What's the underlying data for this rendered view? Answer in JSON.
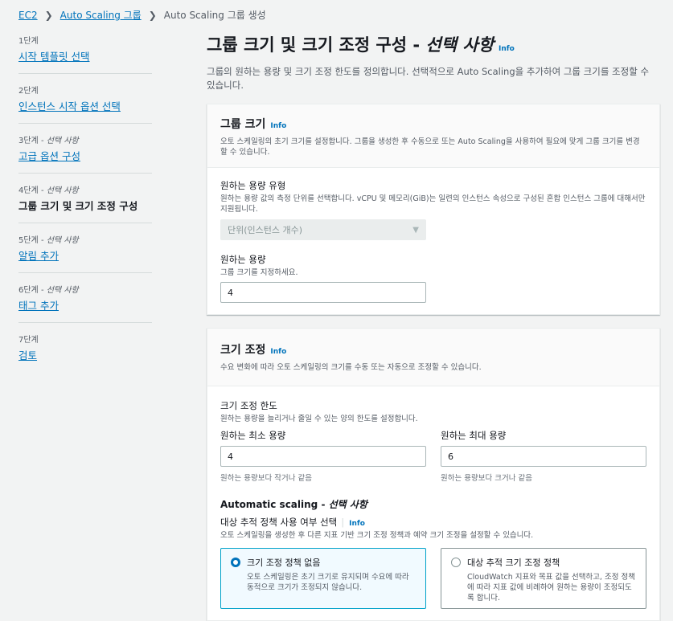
{
  "breadcrumb": {
    "items": [
      "EC2",
      "Auto Scaling 그룹"
    ],
    "current": "Auto Scaling 그룹 생성"
  },
  "steps": [
    {
      "num": "1단계",
      "optional": "",
      "label": "시작 템플릿 선택"
    },
    {
      "num": "2단계",
      "optional": "",
      "label": "인스턴스 시작 옵션 선택"
    },
    {
      "num": "3단계 - ",
      "optional": "선택 사항",
      "label": "고급 옵션 구성"
    },
    {
      "num": "4단계 - ",
      "optional": "선택 사항",
      "label": "그룹 크기 및 크기 조정 구성"
    },
    {
      "num": "5단계 - ",
      "optional": "선택 사항",
      "label": "알림 추가"
    },
    {
      "num": "6단계 - ",
      "optional": "선택 사항",
      "label": "태그 추가"
    },
    {
      "num": "7단계",
      "optional": "",
      "label": "검토"
    }
  ],
  "page": {
    "title": "그룹 크기 및 크기 조정 구성 - ",
    "title_optional": "선택 사항",
    "info": "Info",
    "description": "그룹의 원하는 용량 및 크기 조정 한도를 정의합니다. 선택적으로 Auto Scaling을 추가하여 그룹 크기를 조정할 수 있습니다."
  },
  "group_size": {
    "title": "그룹 크기",
    "info": "Info",
    "description": "오토 스케일링의 초기 크기를 설정합니다. 그룹을 생성한 후 수동으로 또는 Auto Scaling을 사용하여 필요에 맞게 그룹 크기를 변경할 수 있습니다.",
    "capacity_type_label": "원하는 용량 유형",
    "capacity_type_desc": "원하는 용량 값의 측정 단위를 선택합니다. vCPU 및 메모리(GiB)는 일련의 인스턴스 속성으로 구성된 혼합 인스턴스 그룹에 대해서만 지원됩니다.",
    "capacity_type_value": "단위(인스턴스 개수)",
    "desired_label": "원하는 용량",
    "desired_desc": "그룹 크기를 지정하세요.",
    "desired_value": "4"
  },
  "scaling": {
    "title": "크기 조정",
    "info": "Info",
    "description": "수요 변화에 따라 오토 스케일링의 크기를 수동 또는 자동으로 조정할 수 있습니다.",
    "limits_label": "크기 조정 한도",
    "limits_desc": "원하는 용량을 늘리거나 줄일 수 있는 양의 한도를 설정합니다.",
    "min_label": "원하는 최소 용량",
    "min_value": "4",
    "min_hint": "원하는 용량보다 작거나 같음",
    "max_label": "원하는 최대 용량",
    "max_value": "6",
    "max_hint": "원하는 용량보다 크거나 같음",
    "auto_title": "Automatic scaling - ",
    "auto_optional": "선택 사항",
    "policy_label": "대상 추적 정책 사용 여부 선택",
    "policy_info": "Info",
    "policy_desc": "오토 스케일링을 생성한 후 다른 지표 기반 크기 조정 정책과 예약 크기 조정을 설정할 수 있습니다.",
    "options": [
      {
        "title": "크기 조정 정책 없음",
        "desc": "오토 스케일링은 초기 크기로 유지되며 수요에 따라 동적으로 크기가 조정되지 않습니다.",
        "selected": true
      },
      {
        "title": "대상 추적 크기 조정 정책",
        "desc": "CloudWatch 지표와 목표 값을 선택하고, 조정 정책에 따라 지표 값에 비례하여 원하는 용량이 조정되도록 합니다.",
        "selected": false
      }
    ]
  }
}
